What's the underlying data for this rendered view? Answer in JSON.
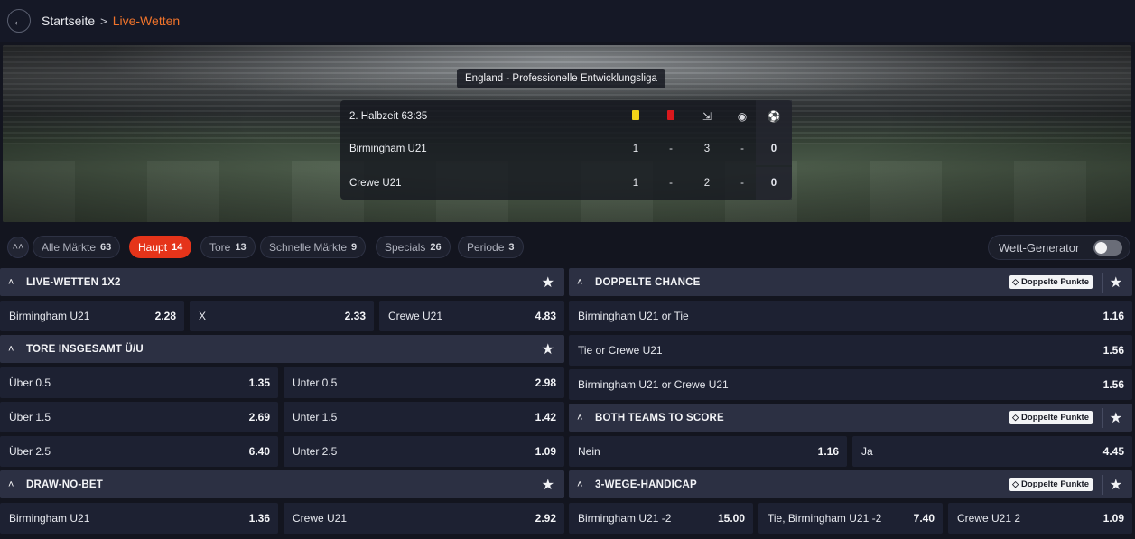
{
  "breadcrumb": {
    "home": "Startseite",
    "separator": ">",
    "current": "Live-Wetten"
  },
  "match": {
    "league": "England - Professionelle Entwicklungsliga",
    "period": "2. Halbzeit 63:35",
    "stat_icons": [
      "yellow-card-icon",
      "red-card-icon",
      "corner-flag-icon",
      "penalty-icon",
      "football-icon"
    ],
    "teams": [
      {
        "name": "Birmingham U21",
        "yellow": "1",
        "red": "-",
        "corners": "3",
        "penalties": "-",
        "score": "0"
      },
      {
        "name": "Crewe U21",
        "yellow": "1",
        "red": "-",
        "corners": "2",
        "penalties": "-",
        "score": "0"
      }
    ]
  },
  "filters": [
    {
      "label": "Alle Märkte",
      "count": "63",
      "active": false
    },
    {
      "label": "Haupt",
      "count": "14",
      "active": true
    },
    {
      "label": "Tore",
      "count": "13",
      "active": false
    },
    {
      "label": "Schnelle Märkte",
      "count": "9",
      "active": false
    },
    {
      "label": "Specials",
      "count": "26",
      "active": false
    },
    {
      "label": "Periode",
      "count": "3",
      "active": false
    }
  ],
  "wett_generator": {
    "label": "Wett-Generator",
    "enabled": false
  },
  "badge_label": "Doppelte Punkte",
  "markets": {
    "live_1x2": {
      "title": "LIVE-WETTEN 1X2",
      "odds": [
        {
          "label": "Birmingham U21",
          "price": "2.28"
        },
        {
          "label": "X",
          "price": "2.33"
        },
        {
          "label": "Crewe U21",
          "price": "4.83"
        }
      ]
    },
    "tore": {
      "title": "TORE INSGESAMT Ü/U",
      "odds": [
        {
          "label": "Über 0.5",
          "price": "1.35"
        },
        {
          "label": "Unter 0.5",
          "price": "2.98"
        },
        {
          "label": "Über 1.5",
          "price": "2.69"
        },
        {
          "label": "Unter 1.5",
          "price": "1.42"
        },
        {
          "label": "Über 2.5",
          "price": "6.40"
        },
        {
          "label": "Unter 2.5",
          "price": "1.09"
        }
      ]
    },
    "dnb": {
      "title": "DRAW-NO-BET",
      "odds": [
        {
          "label": "Birmingham U21",
          "price": "1.36"
        },
        {
          "label": "Crewe U21",
          "price": "2.92"
        }
      ]
    },
    "doppelte_chance": {
      "title": "DOPPELTE CHANCE",
      "odds": [
        {
          "label": "Birmingham U21 or Tie",
          "price": "1.16"
        },
        {
          "label": "Tie or Crewe U21",
          "price": "1.56"
        },
        {
          "label": "Birmingham U21 or Crewe U21",
          "price": "1.56"
        }
      ]
    },
    "btts": {
      "title": "BOTH TEAMS TO SCORE",
      "odds": [
        {
          "label": "Nein",
          "price": "1.16"
        },
        {
          "label": "Ja",
          "price": "4.45"
        }
      ]
    },
    "handicap": {
      "title": "3-WEGE-HANDICAP",
      "odds": [
        {
          "label": "Birmingham U21 -2",
          "price": "15.00"
        },
        {
          "label": "Tie, Birmingham U21 -2",
          "price": "7.40"
        },
        {
          "label": "Crewe U21 2",
          "price": "1.09"
        }
      ]
    }
  }
}
